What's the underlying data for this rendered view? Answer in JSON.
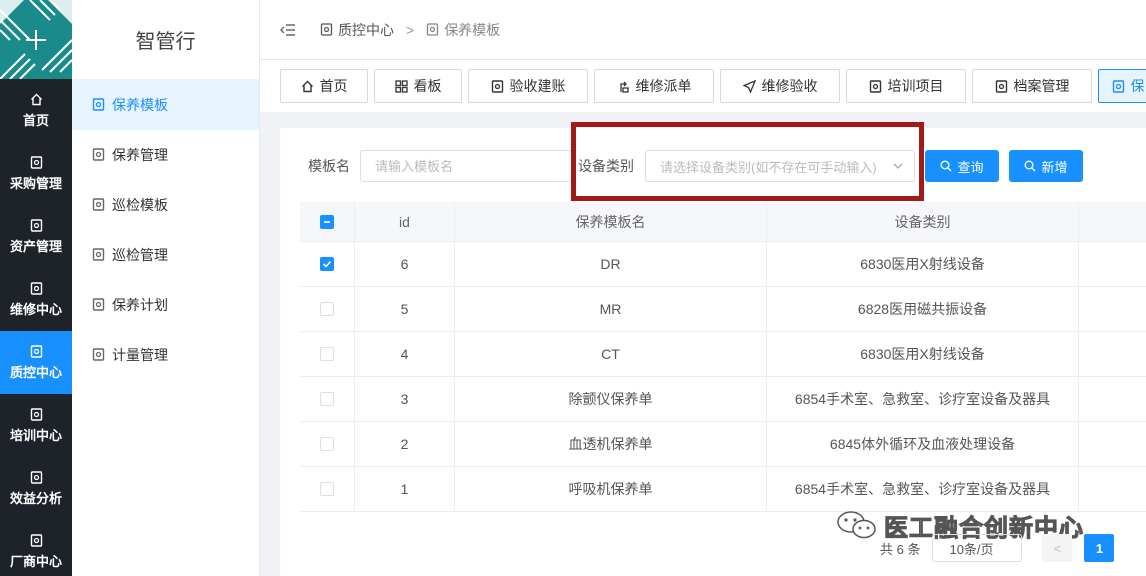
{
  "nav": {
    "items": [
      {
        "label": "首页",
        "icon": "home-icon"
      },
      {
        "label": "采购管理",
        "icon": "document-icon"
      },
      {
        "label": "资产管理",
        "icon": "document-icon"
      },
      {
        "label": "维修中心",
        "icon": "document-icon"
      },
      {
        "label": "质控中心",
        "icon": "document-icon"
      },
      {
        "label": "培训中心",
        "icon": "document-icon"
      },
      {
        "label": "效益分析",
        "icon": "document-icon"
      },
      {
        "label": "厂商中心",
        "icon": "document-icon"
      }
    ],
    "active_index": 4
  },
  "submenu": {
    "title": "智管行",
    "items": [
      {
        "label": "保养模板"
      },
      {
        "label": "保养管理"
      },
      {
        "label": "巡检模板"
      },
      {
        "label": "巡检管理"
      },
      {
        "label": "保养计划"
      },
      {
        "label": "计量管理"
      }
    ],
    "active_index": 0
  },
  "breadcrumb": {
    "items": [
      "质控中心",
      "保养模板"
    ],
    "separator": ">"
  },
  "tabs": [
    {
      "label": "首页",
      "icon": "home-icon"
    },
    {
      "label": "看板",
      "icon": "grid-icon"
    },
    {
      "label": "验收建账",
      "icon": "document-icon"
    },
    {
      "label": "维修派单",
      "icon": "dispatch-icon"
    },
    {
      "label": "维修验收",
      "icon": "send-icon"
    },
    {
      "label": "培训项目",
      "icon": "document-icon"
    },
    {
      "label": "档案管理",
      "icon": "document-icon"
    },
    {
      "label": "保",
      "icon": "document-icon"
    }
  ],
  "filters": {
    "name_label": "模板名",
    "name_placeholder": "请输入模板名",
    "category_label": "设备类别",
    "category_placeholder": "请选择设备类别(如不存在可手动输入)",
    "search_label": "查询",
    "add_label": "新增"
  },
  "table": {
    "headers": [
      "id",
      "保养模板名",
      "设备类别"
    ],
    "rows": [
      {
        "id": "6",
        "name": "DR",
        "category": "6830医用X射线设备",
        "checked": true
      },
      {
        "id": "5",
        "name": "MR",
        "category": "6828医用磁共振设备",
        "checked": false
      },
      {
        "id": "4",
        "name": "CT",
        "category": "6830医用X射线设备",
        "checked": false
      },
      {
        "id": "3",
        "name": "除颤仪保养单",
        "category": "6854手术室、急救室、诊疗室设备及器具",
        "checked": false
      },
      {
        "id": "2",
        "name": "血透机保养单",
        "category": "6845体外循环及血液处理设备",
        "checked": false
      },
      {
        "id": "1",
        "name": "呼吸机保养单",
        "category": "6854手术室、急救室、诊疗室设备及器具",
        "checked": false
      }
    ]
  },
  "pagination": {
    "total_text": "共 6 条",
    "page_size": "10条/页",
    "prev": "<",
    "current_page": "1"
  },
  "watermark": {
    "text": "医工融合创新中心"
  },
  "colors": {
    "primary": "#1890ff",
    "nav_bg": "#1e2229",
    "logo_bg": "#1b8a8a",
    "highlight": "#a01a1a"
  }
}
